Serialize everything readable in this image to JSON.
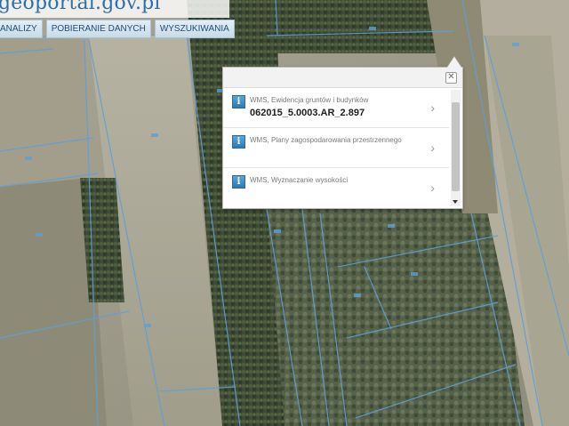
{
  "header": {
    "logo_text": "eoportal.gov.pl",
    "logo_g": "g",
    "nav": [
      "ANALIZY",
      "POBIERANIE DANYCH",
      "WYSZUKIWANIA"
    ]
  },
  "popup": {
    "close_icon": "close-icon",
    "rows": [
      {
        "title": "WMS, Ewidencja gruntów i budynków",
        "value": "062015_5.0003.AR_2.897"
      },
      {
        "title": "WMS, Plany zagospodarowania przestrzennego",
        "value": ""
      },
      {
        "title": "WMS, Wyznaczanie wysokości",
        "value": ""
      }
    ]
  },
  "colors": {
    "parcel_line": "#5f9fd6",
    "accent": "#2f6fa7"
  }
}
